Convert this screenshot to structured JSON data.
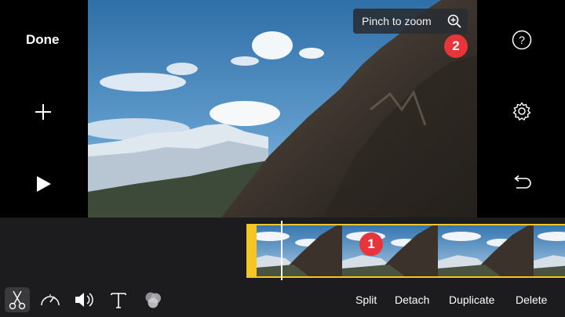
{
  "sidebar_left": {
    "done_label": "Done"
  },
  "tooltip": {
    "text": "Pinch to zoom"
  },
  "badges": {
    "clip_badge": "1",
    "zoom_badge": "2"
  },
  "toolbar": {
    "actions": [
      "Split",
      "Detach",
      "Duplicate",
      "Delete"
    ],
    "tools": [
      "scissors-icon",
      "speed-gauge-icon",
      "volume-icon",
      "text-icon",
      "filters-icon"
    ]
  },
  "colors": {
    "accent": "#f4c525",
    "badge": "#e8353b",
    "background": "#000000",
    "toolbar": "#1c1c1e"
  }
}
